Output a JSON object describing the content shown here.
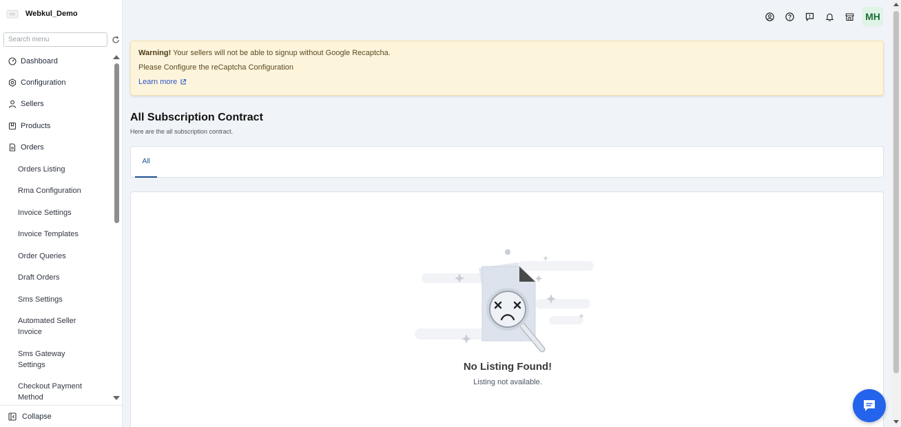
{
  "brand": {
    "name": "Webkul_Demo"
  },
  "sidebar": {
    "search_placeholder": "Search menu",
    "items": [
      {
        "label": "Dashboard",
        "icon": "dashboard-icon"
      },
      {
        "label": "Configuration",
        "icon": "gear-icon"
      },
      {
        "label": "Sellers",
        "icon": "user-icon"
      },
      {
        "label": "Products",
        "icon": "product-icon"
      },
      {
        "label": "Orders",
        "icon": "orders-icon"
      }
    ],
    "sub_items": [
      "Orders Listing",
      "Rma Configuration",
      "Invoice Settings",
      "Invoice Templates",
      "Order Queries",
      "Draft Orders",
      "Sms Settings",
      "Automated Seller Invoice",
      "Sms Gateway Settings",
      "Checkout Payment Method"
    ],
    "collapse_label": "Collapse"
  },
  "topbar": {
    "icons": [
      "account-icon",
      "help-icon",
      "feedback-icon",
      "bell-icon",
      "store-icon"
    ],
    "avatar_initials": "MH"
  },
  "warning": {
    "strong": "Warning!",
    "line1": "Your sellers will not be able to signup without Google Recaptcha.",
    "line2": "Please Configure the reCaptcha Configuration",
    "link": "Learn more"
  },
  "page": {
    "title": "All Subscription Contract",
    "subtitle": "Here are the all subscription contract."
  },
  "tabs": [
    {
      "label": "All",
      "active": true
    }
  ],
  "empty_state": {
    "title": "No Listing Found!",
    "subtitle": "Listing not available."
  },
  "colors": {
    "accent": "#2463eb",
    "tab_active": "#1b4f8c",
    "warning_bg": "#fdf4dc",
    "avatar_bg": "#dff3e6"
  }
}
